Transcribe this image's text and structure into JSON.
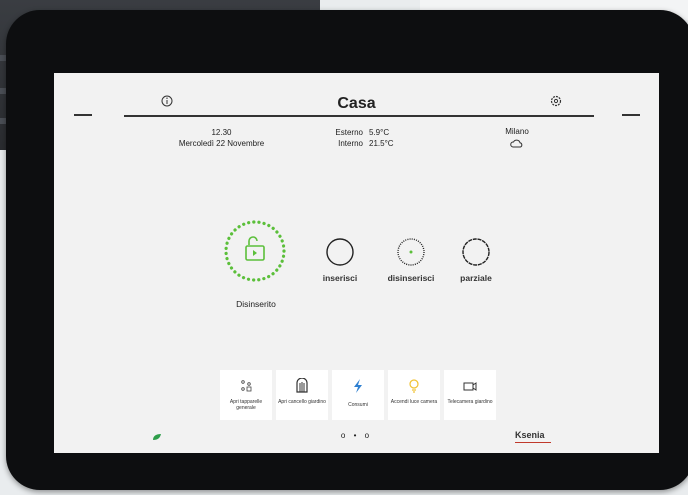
{
  "header": {
    "title": "Casa"
  },
  "datetime": {
    "time": "12.30",
    "date": "Mercoledì 22 Novembre"
  },
  "weather": {
    "external_label": "Esterno",
    "external_value": "5.9°C",
    "internal_label": "Interno",
    "internal_value": "21.5°C",
    "city": "Milano",
    "icon": "cloud-icon"
  },
  "status": {
    "label": "Disinserito",
    "icon": "unlocked-padlock-icon",
    "color": "#5bbf3a"
  },
  "modes": [
    {
      "label": "inserisci"
    },
    {
      "label": "disinserisci"
    },
    {
      "label": "parziale"
    }
  ],
  "shortcuts": [
    {
      "label": "Apri tapparelle generale",
      "icon": "blinds-icon"
    },
    {
      "label": "Apri cancello giardino",
      "icon": "gate-icon"
    },
    {
      "label": "Consumi",
      "icon": "lightning-icon"
    },
    {
      "label": "Accendi luce camera",
      "icon": "bulb-icon"
    },
    {
      "label": "Telecamera giardino",
      "icon": "camera-icon"
    }
  ],
  "footer": {
    "page_dots": "o • o",
    "brand": "Ksenia"
  },
  "colors": {
    "accent": "#5bbf3a",
    "lightning": "#2d7fd1",
    "bulb": "#f1c232",
    "brand_red": "#c0392b"
  }
}
